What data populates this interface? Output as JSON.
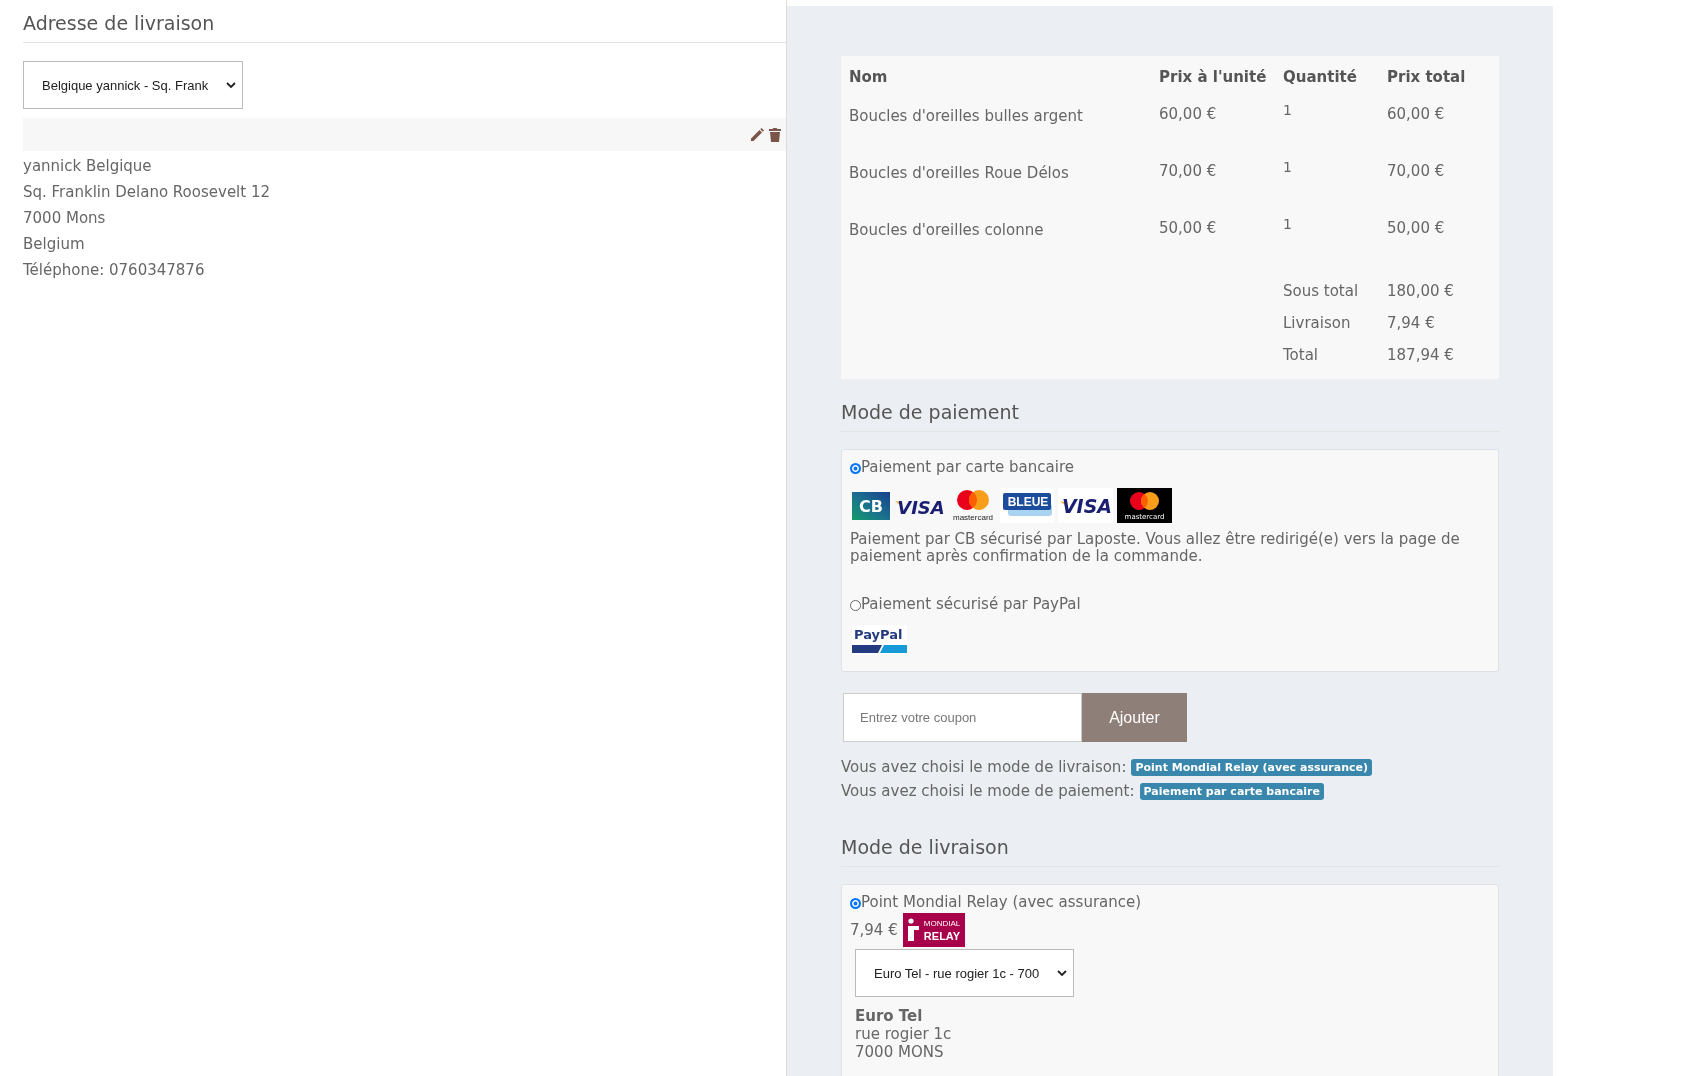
{
  "address": {
    "title": "Adresse de livraison",
    "select_value": "Belgique yannick - Sq. Frank",
    "lines": [
      "yannick Belgique",
      "Sq. Franklin Delano Roosevelt 12",
      "7000 Mons",
      "Belgium",
      "Téléphone: 0760347876"
    ]
  },
  "order": {
    "columns": [
      "Nom",
      "Prix à l'unité",
      "Quantité",
      "Prix total"
    ],
    "rows": [
      {
        "name": "Boucles d'oreilles bulles argent",
        "unit_price": "60,00 €",
        "quantity": "1",
        "total": "60,00 €"
      },
      {
        "name": "Boucles d'oreilles Roue Délos",
        "unit_price": "70,00 €",
        "quantity": "1",
        "total": "70,00 €"
      },
      {
        "name": "Boucles d'oreilles colonne",
        "unit_price": "50,00 €",
        "quantity": "1",
        "total": "50,00 €"
      }
    ],
    "totals": [
      {
        "label": "Sous total",
        "value": "180,00 €"
      },
      {
        "label": "Livraison",
        "value": "7,94 €"
      },
      {
        "label": "Total",
        "value": "187,94 €"
      }
    ]
  },
  "payment": {
    "title": "Mode de paiement",
    "options": [
      {
        "label": "Paiement par carte bancaire",
        "selected": true,
        "logos": [
          {
            "kind": "cb",
            "text": "CB"
          },
          {
            "kind": "visa",
            "text": "VISA"
          },
          {
            "kind": "mastercard",
            "text": "mastercard"
          },
          {
            "kind": "bleue",
            "text": "BLEUE"
          },
          {
            "kind": "visa_boxed",
            "text": "VISA"
          },
          {
            "kind": "mastercard_dark",
            "text": "mastercard"
          }
        ],
        "description": "Paiement par CB sécurisé par Laposte. Vous allez être redirigé(e) vers la page de paiement après confirmation de la commande."
      },
      {
        "label": "Paiement sécurisé par PayPal",
        "selected": false,
        "logos": [
          {
            "kind": "paypal",
            "text": "PayPal"
          }
        ]
      }
    ]
  },
  "coupon": {
    "placeholder": "Entrez votre coupon",
    "button": "Ajouter"
  },
  "choices": [
    {
      "text": "Vous avez choisi le mode de livraison:",
      "badge": "Point Mondial Relay (avec assurance)"
    },
    {
      "text": "Vous avez choisi le mode de paiement:",
      "badge": "Paiement par carte bancaire"
    }
  ],
  "delivery": {
    "title": "Mode de livraison",
    "options": [
      {
        "label": "Point Mondial Relay (avec assurance)",
        "selected": true,
        "price": "7,94 €",
        "logo": {
          "kind": "mondial_relay",
          "small_text": "MONDIAL",
          "text": "RELAY"
        },
        "select_value": "Euro Tel - rue rogier 1c - 700",
        "relay_name": "Euro Tel",
        "relay_lines": [
          "rue rogier 1c",
          "7000 MONS"
        ]
      }
    ]
  }
}
